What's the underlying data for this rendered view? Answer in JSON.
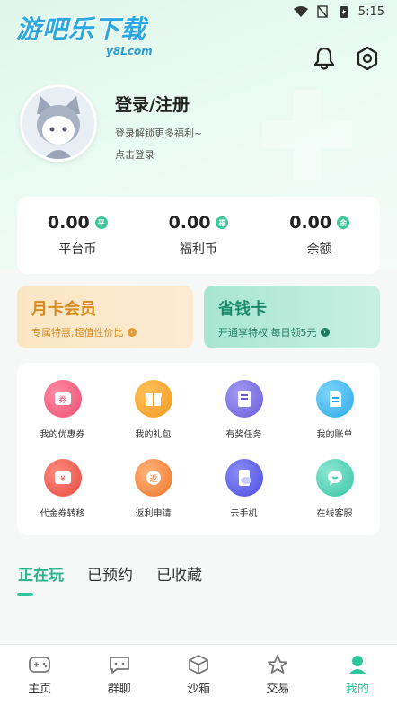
{
  "status_bar": {
    "time": "5:15"
  },
  "logo": {
    "main": "游吧乐下载",
    "sub": "y8Lcom"
  },
  "profile": {
    "title": "登录/注册",
    "subtitle": "登录解锁更多福利~",
    "link": "点击登录"
  },
  "wallet": [
    {
      "value": "0.00",
      "badge": "平",
      "label": "平台币"
    },
    {
      "value": "0.00",
      "badge": "福",
      "label": "福利币"
    },
    {
      "value": "0.00",
      "badge": "余",
      "label": "余额"
    }
  ],
  "promo": {
    "monthly": {
      "title": "月卡会员",
      "subtitle": "专属特惠,超值性价比"
    },
    "saver": {
      "title": "省钱卡",
      "subtitle": "开通享特权,每日领5元"
    }
  },
  "grid": [
    {
      "label": "我的优惠券",
      "icon": "coupon-icon",
      "color": "#f0607e"
    },
    {
      "label": "我的礼包",
      "icon": "gift-icon",
      "color": "#f6a12a"
    },
    {
      "label": "有奖任务",
      "icon": "task-icon",
      "color": "#7667e3"
    },
    {
      "label": "我的账单",
      "icon": "bill-icon",
      "color": "#35b6ea"
    },
    {
      "label": "代金券转移",
      "icon": "voucher-transfer-icon",
      "color": "#ee5a50"
    },
    {
      "label": "返利申请",
      "icon": "rebate-icon",
      "color": "#f6843a"
    },
    {
      "label": "云手机",
      "icon": "cloud-phone-icon",
      "color": "#5b5fe6"
    },
    {
      "label": "在线客服",
      "icon": "customer-service-icon",
      "color": "#4ccfb0"
    }
  ],
  "tabs": [
    {
      "label": "正在玩",
      "active": true
    },
    {
      "label": "已预约",
      "active": false
    },
    {
      "label": "已收藏",
      "active": false
    }
  ],
  "nav": [
    {
      "label": "主页",
      "icon": "gamepad-icon"
    },
    {
      "label": "群聊",
      "icon": "chat-icon"
    },
    {
      "label": "沙箱",
      "icon": "cube-icon"
    },
    {
      "label": "交易",
      "icon": "star-icon"
    },
    {
      "label": "我的",
      "icon": "user-icon",
      "active": true
    }
  ],
  "colors": {
    "accent": "#2bc79a",
    "monthly": "#d78a1e",
    "saver": "#1a8c6a"
  }
}
